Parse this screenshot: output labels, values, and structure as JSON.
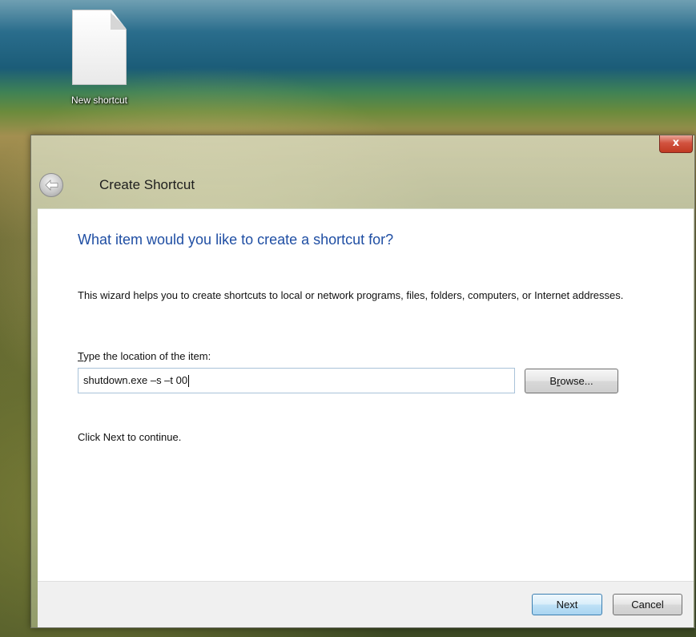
{
  "desktop": {
    "icon_label": "New shortcut",
    "icon_name": "document-icon"
  },
  "window": {
    "title": "Create Shortcut",
    "close_label": "x",
    "back_icon": "back-arrow-icon"
  },
  "content": {
    "heading": "What item would you like to create a shortcut for?",
    "description": "This wizard helps you to create shortcuts to local or network programs, files, folders, computers, or Internet addresses.",
    "field_label_mnemonic": "T",
    "field_label_rest": "ype the location of the item:",
    "location_value": "shutdown.exe –s –t 00",
    "browse_mnemonic": "r",
    "browse_before": "B",
    "browse_after": "owse...",
    "continue_text": "Click Next to continue."
  },
  "footer": {
    "next_label": "Next",
    "cancel_label": "Cancel"
  },
  "colors": {
    "heading": "#1f4ea3",
    "close_button": "#c13a22",
    "input_border": "#a9c2d9"
  }
}
